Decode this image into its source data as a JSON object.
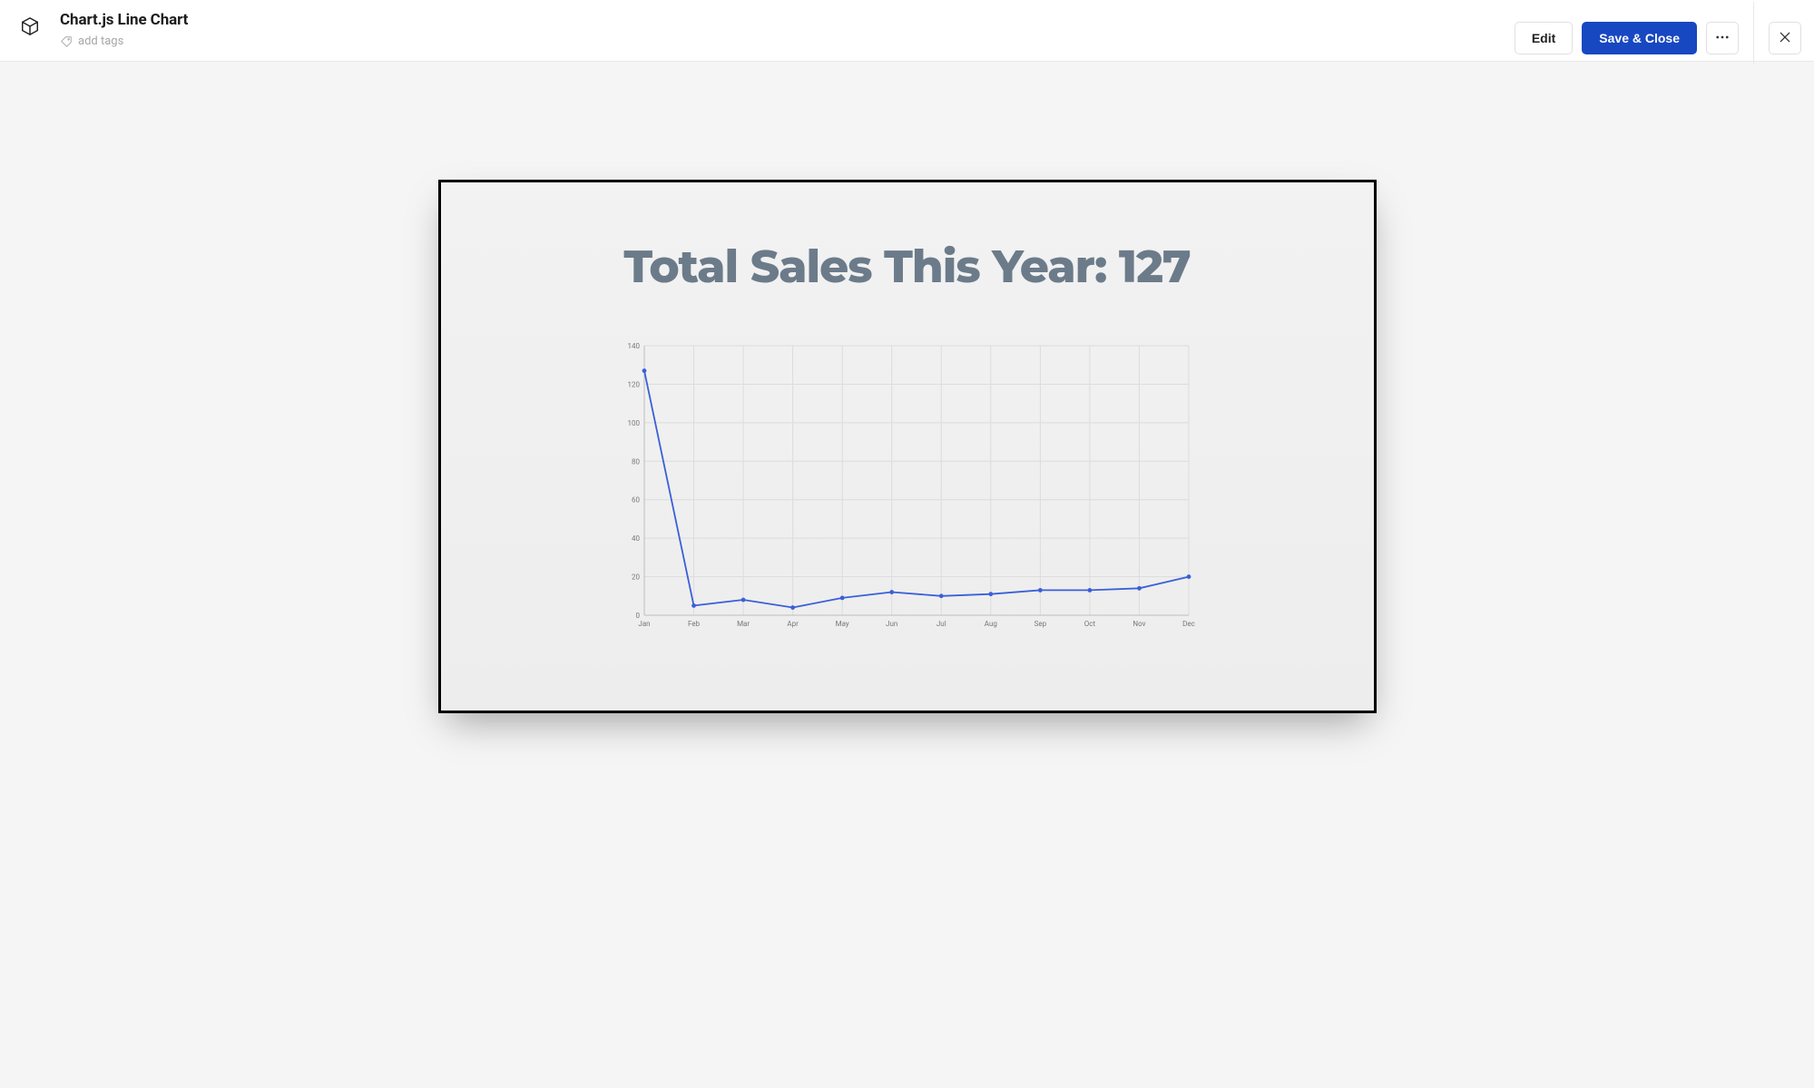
{
  "header": {
    "title": "Chart.js Line Chart",
    "add_tags_placeholder": "add tags",
    "edit_label": "Edit",
    "save_close_label": "Save & Close"
  },
  "chart_data": {
    "type": "line",
    "title": "Total Sales This Year: 127",
    "categories": [
      "Jan",
      "Feb",
      "Mar",
      "Apr",
      "May",
      "Jun",
      "Jul",
      "Aug",
      "Sep",
      "Oct",
      "Nov",
      "Dec"
    ],
    "values": [
      127,
      5,
      8,
      4,
      9,
      12,
      10,
      11,
      13,
      13,
      14,
      20
    ],
    "ylabel": "",
    "xlabel": "",
    "ylim": [
      0,
      140
    ],
    "yticks": [
      0,
      20,
      40,
      60,
      80,
      100,
      120,
      140
    ],
    "grid": true,
    "line_color": "#3a5fd9"
  }
}
